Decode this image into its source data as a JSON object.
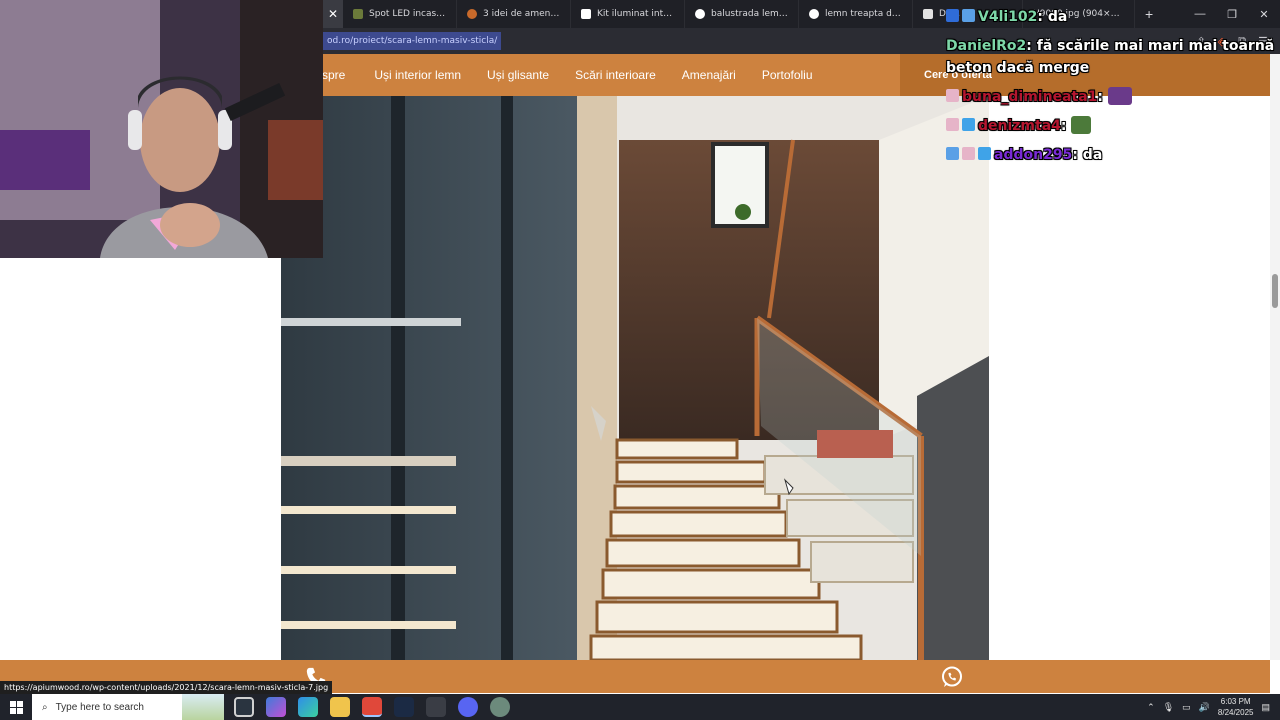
{
  "browser": {
    "tabs": [
      {
        "label": "Spot LED incastrabil &..."
      },
      {
        "label": "3 idei de amenajare pe..."
      },
      {
        "label": "Kit iluminat inteligent ..."
      },
      {
        "label": "balustrada lemn - Căut..."
      },
      {
        "label": "lemn treapta dedeman..."
      },
      {
        "label": "De..."
      },
      {
        "label": "H9090.jpg (904×12..."
      }
    ],
    "url": "od.ro/proiect/scara-lemn-masiv-sticla/",
    "new_tab_symbol": "+"
  },
  "site": {
    "nav": [
      {
        "label": "spre"
      },
      {
        "label": "Uși interior lemn"
      },
      {
        "label": "Uși glisante"
      },
      {
        "label": "Scări interioare"
      },
      {
        "label": "Amenajări"
      },
      {
        "label": "Portofoliu"
      }
    ],
    "cta_label": "Cere o ofertă"
  },
  "status_link": "https://apiumwood.ro/wp-content/uploads/2021/12/scara-lemn-masiv-sticla-7.jpg",
  "chat": [
    {
      "user": "V4li102",
      "message": "da",
      "color": "#ffffff"
    },
    {
      "user": "DanielRo2",
      "message": "fă scările mai mari mai toarnă beton dacă merge",
      "color": "#7dd7a8"
    },
    {
      "user": "buna_dimineata1",
      "message": "",
      "color": "#b5162f"
    },
    {
      "user": "denizmta4",
      "message": "",
      "color": "#b5162f"
    },
    {
      "user": "addon295",
      "message": "da",
      "color": "#7a2bd6"
    }
  ],
  "taskbar": {
    "search_placeholder": "Type here to search",
    "time": "6:03 PM",
    "date": "8/24/2025"
  },
  "colors": {
    "site_orange": "#cd823f",
    "site_orange_dark": "#b56d2b",
    "browser_dark": "#1f2026"
  }
}
